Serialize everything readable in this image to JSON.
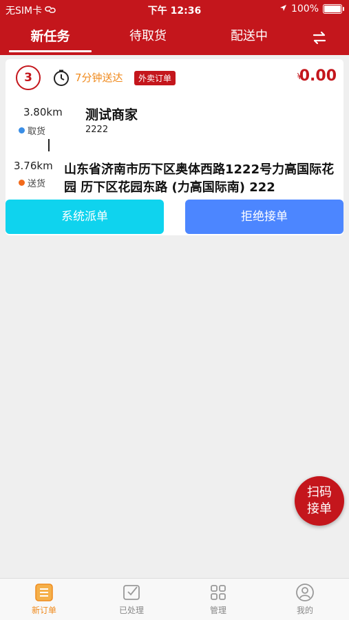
{
  "status_bar": {
    "carrier": "无SIM卡",
    "time": "下午 12:36",
    "battery": "100%"
  },
  "tabs": [
    {
      "label": "新任务",
      "active": true
    },
    {
      "label": "待取货",
      "active": false
    },
    {
      "label": "配送中",
      "active": false
    }
  ],
  "order": {
    "index": "3",
    "deliver_time": "7分钟送达",
    "tag": "外卖订单",
    "price_symbol": "¥",
    "price": "0.00",
    "pickup_distance": "3.80km",
    "pickup_label": "取货",
    "merchant_name": "测试商家",
    "merchant_code": "2222",
    "delivery_distance": "3.76km",
    "delivery_label": "送货",
    "address": "山东省济南市历下区奥体西路1222号力高国际花园 历下区花园东路 (力高国际南) 222",
    "buttons": {
      "system_dispatch": "系统派单",
      "reject": "拒绝接单"
    }
  },
  "scan_button": {
    "line1": "扫码",
    "line2": "接单"
  },
  "tabbar": [
    {
      "label": "新订单",
      "icon": "new-order-icon",
      "active": true
    },
    {
      "label": "已处理",
      "icon": "processed-icon",
      "active": false
    },
    {
      "label": "管理",
      "icon": "grid-icon",
      "active": false
    },
    {
      "label": "我的",
      "icon": "profile-icon",
      "active": false
    }
  ],
  "colors": {
    "brand": "#c4161c",
    "accent_orange": "#f08a1c",
    "button_cyan": "#0fd3ee",
    "button_blue": "#4c86ff",
    "pickup_dot": "#3a8ee6",
    "delivery_dot": "#f26a1b"
  }
}
